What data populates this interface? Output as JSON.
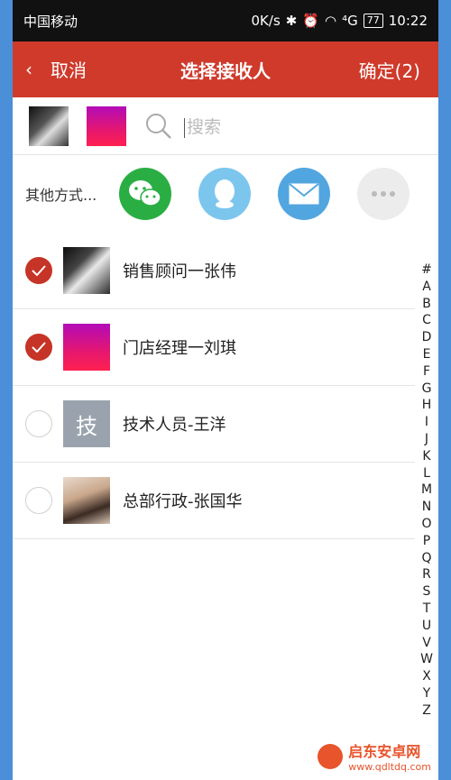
{
  "status": {
    "carrier": "中国移动",
    "speed": "0K/s",
    "signal": "⁴G",
    "battery": "77",
    "time": "10:22"
  },
  "header": {
    "back_label": "取消",
    "title": "选择接收人",
    "confirm_label": "确定(2)"
  },
  "search": {
    "placeholder": "搜索"
  },
  "share": {
    "label": "其他方式...",
    "options": [
      "wechat-icon",
      "qq-icon",
      "mail-icon",
      "more-icon"
    ]
  },
  "contacts": [
    {
      "name": "销售顾问一张伟",
      "checked": true,
      "avatar": "photo"
    },
    {
      "name": "门店经理一刘琪",
      "checked": true,
      "avatar": "pink"
    },
    {
      "name": "技术人员-王洋",
      "checked": false,
      "avatar_text": "技"
    },
    {
      "name": "总部行政-张国华",
      "checked": false,
      "avatar": "photo"
    }
  ],
  "index": [
    "#",
    "A",
    "B",
    "C",
    "D",
    "E",
    "F",
    "G",
    "H",
    "I",
    "J",
    "K",
    "L",
    "M",
    "N",
    "O",
    "P",
    "Q",
    "R",
    "S",
    "T",
    "U",
    "V",
    "W",
    "X",
    "Y",
    "Z"
  ],
  "watermark": {
    "name": "启东安卓网",
    "url": "www.qdltdq.com"
  },
  "colors": {
    "header": "#cf3a2b",
    "check": "#c53426",
    "wechat": "#2aae43",
    "qq": "#7cc6ee",
    "mail": "#52a6e0"
  }
}
